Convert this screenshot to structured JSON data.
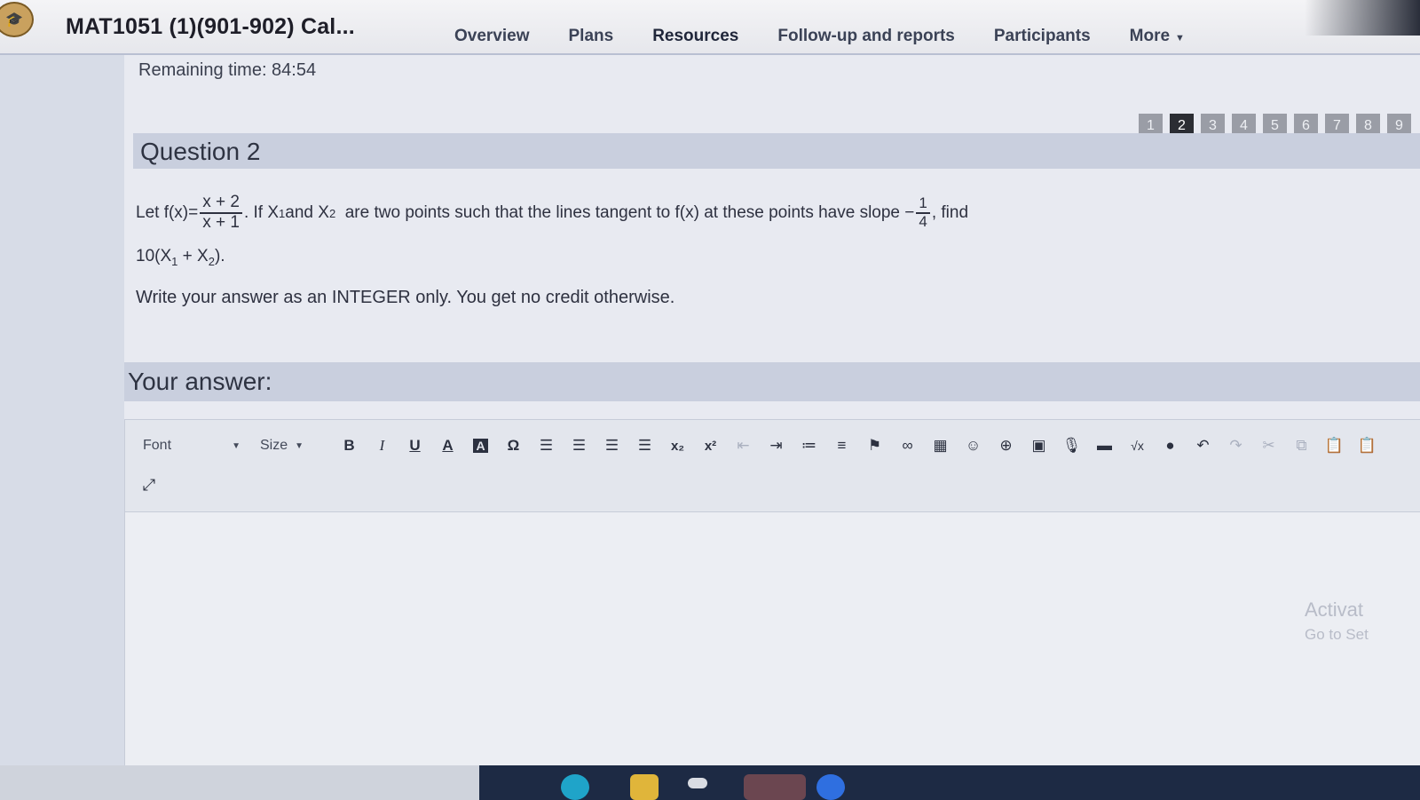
{
  "header": {
    "course_title": "MAT1051 (1)(901-902) Cal...",
    "nav": [
      {
        "label": "Overview"
      },
      {
        "label": "Plans"
      },
      {
        "label": "Resources"
      },
      {
        "label": "Follow-up and reports"
      },
      {
        "label": "Participants"
      },
      {
        "label": "More"
      }
    ]
  },
  "quiz": {
    "remaining_time": "Remaining time: 84:54",
    "pages": [
      "1",
      "2",
      "3",
      "4",
      "5",
      "6",
      "7",
      "8",
      "9"
    ],
    "current_page": "2",
    "question_title": "Question 2",
    "q": {
      "let": "Let f(x)=",
      "num": "x + 2",
      "den": "x + 1",
      "if": ". If X",
      "sub1": "1",
      "and": " and X",
      "sub2": "2",
      "rest": "  are two points such that the lines tangent to f(x) at these points have slope −",
      "slope_num": "1",
      "slope_den": "4",
      "find": ", find",
      "expr_a": "10(X",
      "expr_sub1": "1",
      "expr_b": " + X",
      "expr_sub2": "2",
      "expr_c": ").",
      "instruction": "Write your answer as an INTEGER only. You get no credit otherwise."
    },
    "answer_title": "Your answer:"
  },
  "editor": {
    "font_label": "Font",
    "size_label": "Size",
    "buttons": {
      "bold": "B",
      "italic": "I",
      "underline": "U",
      "textcolor": "A",
      "bgcolor": "A",
      "omega": "Ω",
      "subscript": "x₂",
      "superscript": "x²",
      "sqrt": "√x"
    }
  },
  "watermark": {
    "line1": "Activat",
    "line2": "Go to Set"
  }
}
